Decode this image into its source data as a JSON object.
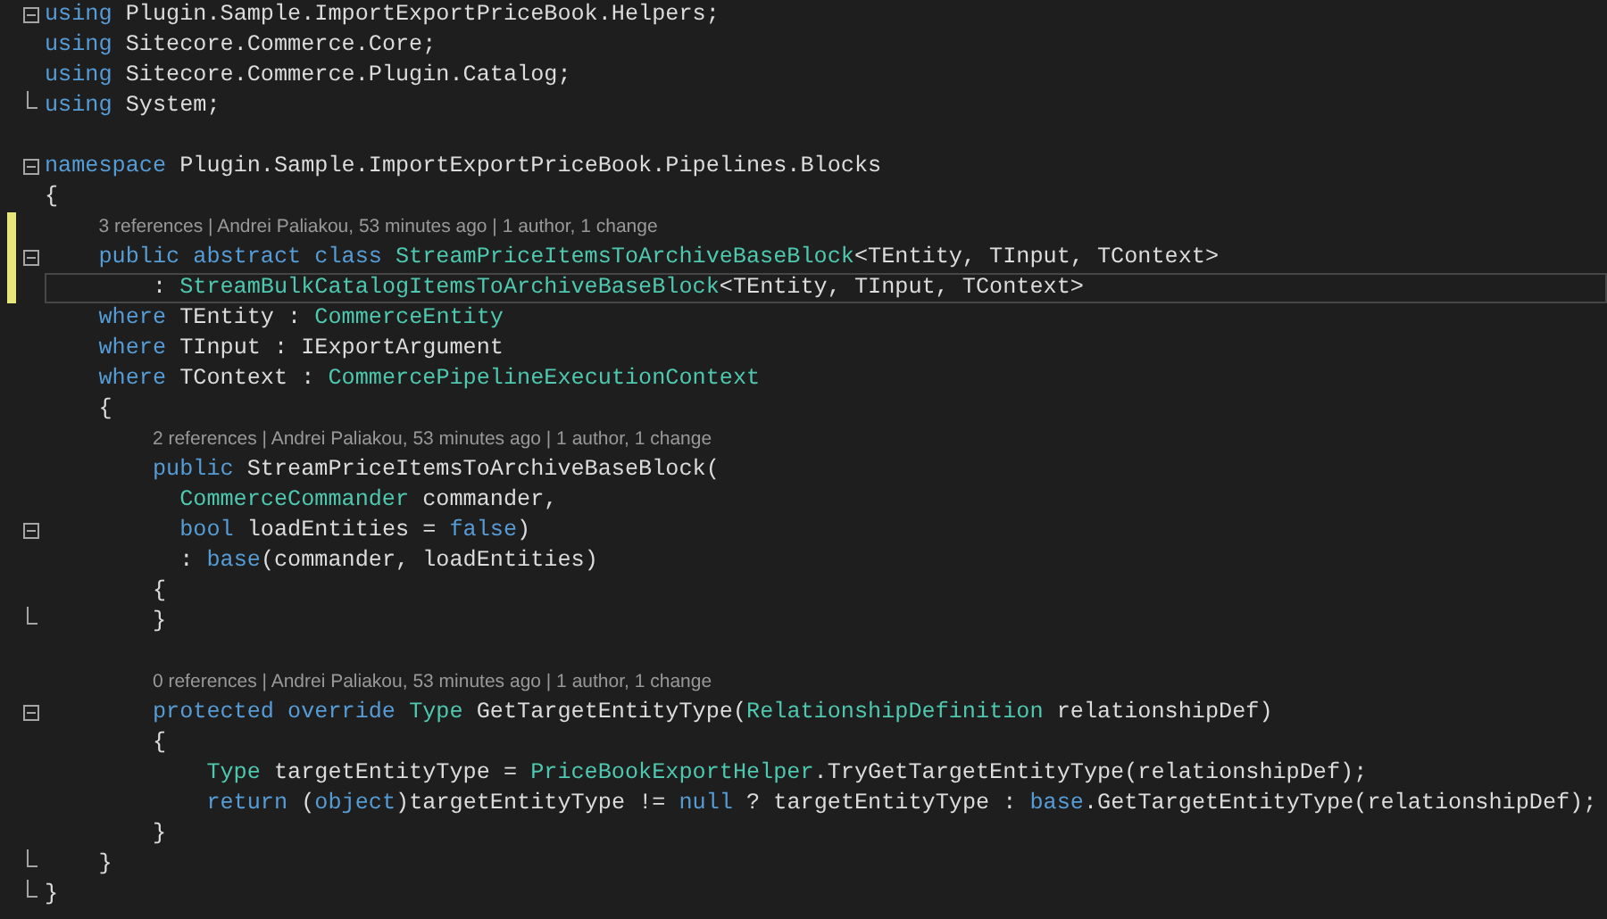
{
  "editor": {
    "lines": [
      {
        "kind": "code",
        "collapsible": true,
        "fold_end": false,
        "changed": false,
        "current": false,
        "tokens": [
          {
            "kind": "keyword",
            "text": "using"
          },
          {
            "kind": "plain",
            "text": " Plugin.Sample.ImportExportPriceBook.Helpers;"
          }
        ]
      },
      {
        "kind": "code",
        "collapsible": false,
        "fold_end": false,
        "changed": false,
        "current": false,
        "tokens": [
          {
            "kind": "keyword",
            "text": "using"
          },
          {
            "kind": "plain",
            "text": " Sitecore.Commerce.Core;"
          }
        ]
      },
      {
        "kind": "code",
        "collapsible": false,
        "fold_end": false,
        "changed": false,
        "current": false,
        "tokens": [
          {
            "kind": "keyword",
            "text": "using"
          },
          {
            "kind": "plain",
            "text": " Sitecore.Commerce.Plugin.Catalog;"
          }
        ]
      },
      {
        "kind": "code",
        "collapsible": false,
        "fold_end": true,
        "changed": false,
        "current": false,
        "tokens": [
          {
            "kind": "keyword",
            "text": "using"
          },
          {
            "kind": "plain",
            "text": " System;"
          }
        ]
      },
      {
        "kind": "blank"
      },
      {
        "kind": "code",
        "collapsible": true,
        "fold_end": false,
        "changed": false,
        "current": false,
        "tokens": [
          {
            "kind": "keyword",
            "text": "namespace"
          },
          {
            "kind": "plain",
            "text": " Plugin.Sample.ImportExportPriceBook.Pipelines.Blocks"
          }
        ]
      },
      {
        "kind": "code",
        "collapsible": false,
        "fold_end": false,
        "changed": false,
        "current": false,
        "tokens": [
          {
            "kind": "plain",
            "text": "{"
          }
        ]
      },
      {
        "kind": "lens",
        "collapsible": false,
        "fold_end": false,
        "changed": true,
        "current": false,
        "text": "3 references | Andrei Paliakou, 53 minutes ago | 1 author, 1 change"
      },
      {
        "kind": "code",
        "collapsible": true,
        "fold_end": false,
        "changed": true,
        "current": false,
        "tokens": [
          {
            "kind": "keyword",
            "text": "    public abstract class "
          },
          {
            "kind": "type",
            "text": "StreamPriceItemsToArchiveBaseBlock"
          },
          {
            "kind": "plain",
            "text": "<TEntity, TInput, TContext>"
          }
        ]
      },
      {
        "kind": "code",
        "collapsible": false,
        "fold_end": false,
        "changed": true,
        "current": true,
        "tokens": [
          {
            "kind": "plain",
            "text": "        : "
          },
          {
            "kind": "type",
            "text": "StreamBulkCatalogItemsToArchiveBaseBlock"
          },
          {
            "kind": "plain",
            "text": "<TEntity, TInput, TContext>"
          }
        ]
      },
      {
        "kind": "code",
        "collapsible": false,
        "fold_end": false,
        "changed": false,
        "current": false,
        "tokens": [
          {
            "kind": "keyword",
            "text": "    where"
          },
          {
            "kind": "plain",
            "text": " TEntity : "
          },
          {
            "kind": "type",
            "text": "CommerceEntity"
          }
        ]
      },
      {
        "kind": "code",
        "collapsible": false,
        "fold_end": false,
        "changed": false,
        "current": false,
        "tokens": [
          {
            "kind": "keyword",
            "text": "    where"
          },
          {
            "kind": "plain",
            "text": " TInput : IExportArgument"
          }
        ]
      },
      {
        "kind": "code",
        "collapsible": false,
        "fold_end": false,
        "changed": false,
        "current": false,
        "tokens": [
          {
            "kind": "keyword",
            "text": "    where"
          },
          {
            "kind": "plain",
            "text": " TContext : "
          },
          {
            "kind": "type",
            "text": "CommercePipelineExecutionContext"
          }
        ]
      },
      {
        "kind": "code",
        "collapsible": false,
        "fold_end": false,
        "changed": false,
        "current": false,
        "tokens": [
          {
            "kind": "plain",
            "text": "    {"
          }
        ]
      },
      {
        "kind": "lens",
        "collapsible": false,
        "fold_end": false,
        "changed": false,
        "current": false,
        "text": "2 references | Andrei Paliakou, 53 minutes ago | 1 author, 1 change"
      },
      {
        "kind": "code",
        "collapsible": false,
        "fold_end": false,
        "changed": false,
        "current": false,
        "tokens": [
          {
            "kind": "keyword",
            "text": "        public"
          },
          {
            "kind": "plain",
            "text": " StreamPriceItemsToArchiveBaseBlock("
          }
        ]
      },
      {
        "kind": "code",
        "collapsible": false,
        "fold_end": false,
        "changed": false,
        "current": false,
        "tokens": [
          {
            "kind": "type",
            "text": "          CommerceCommander"
          },
          {
            "kind": "plain",
            "text": " commander,"
          }
        ]
      },
      {
        "kind": "code",
        "collapsible": true,
        "fold_end": false,
        "changed": false,
        "current": false,
        "tokens": [
          {
            "kind": "keyword",
            "text": "          bool"
          },
          {
            "kind": "plain",
            "text": " loadEntities = "
          },
          {
            "kind": "keyword",
            "text": "false"
          },
          {
            "kind": "plain",
            "text": ")"
          }
        ]
      },
      {
        "kind": "code",
        "collapsible": false,
        "fold_end": false,
        "changed": false,
        "current": false,
        "tokens": [
          {
            "kind": "plain",
            "text": "          : "
          },
          {
            "kind": "keyword",
            "text": "base"
          },
          {
            "kind": "plain",
            "text": "(commander, loadEntities)"
          }
        ]
      },
      {
        "kind": "code",
        "collapsible": false,
        "fold_end": false,
        "changed": false,
        "current": false,
        "tokens": [
          {
            "kind": "plain",
            "text": "        {"
          }
        ]
      },
      {
        "kind": "code",
        "collapsible": false,
        "fold_end": true,
        "changed": false,
        "current": false,
        "tokens": [
          {
            "kind": "plain",
            "text": "        }"
          }
        ]
      },
      {
        "kind": "blank"
      },
      {
        "kind": "lens",
        "collapsible": false,
        "fold_end": false,
        "changed": false,
        "current": false,
        "text": "0 references | Andrei Paliakou, 53 minutes ago | 1 author, 1 change"
      },
      {
        "kind": "code",
        "collapsible": true,
        "fold_end": false,
        "changed": false,
        "current": false,
        "tokens": [
          {
            "kind": "keyword",
            "text": "        protected override "
          },
          {
            "kind": "type",
            "text": "Type"
          },
          {
            "kind": "plain",
            "text": " GetTargetEntityType("
          },
          {
            "kind": "type",
            "text": "RelationshipDefinition"
          },
          {
            "kind": "plain",
            "text": " relationshipDef)"
          }
        ]
      },
      {
        "kind": "code",
        "collapsible": false,
        "fold_end": false,
        "changed": false,
        "current": false,
        "tokens": [
          {
            "kind": "plain",
            "text": "        {"
          }
        ]
      },
      {
        "kind": "code",
        "collapsible": false,
        "fold_end": false,
        "changed": false,
        "current": false,
        "tokens": [
          {
            "kind": "type",
            "text": "            Type"
          },
          {
            "kind": "plain",
            "text": " targetEntityType = "
          },
          {
            "kind": "type",
            "text": "PriceBookExportHelper"
          },
          {
            "kind": "plain",
            "text": ".TryGetTargetEntityType(relationshipDef);"
          }
        ]
      },
      {
        "kind": "code",
        "collapsible": false,
        "fold_end": false,
        "changed": false,
        "current": false,
        "tokens": [
          {
            "kind": "keyword",
            "text": "            return"
          },
          {
            "kind": "plain",
            "text": " ("
          },
          {
            "kind": "keyword",
            "text": "object"
          },
          {
            "kind": "plain",
            "text": ")targetEntityType != "
          },
          {
            "kind": "keyword",
            "text": "null"
          },
          {
            "kind": "plain",
            "text": " ? targetEntityType : "
          },
          {
            "kind": "keyword",
            "text": "base"
          },
          {
            "kind": "plain",
            "text": ".GetTargetEntityType(relationshipDef);"
          }
        ]
      },
      {
        "kind": "code",
        "collapsible": false,
        "fold_end": false,
        "changed": false,
        "current": false,
        "tokens": [
          {
            "kind": "plain",
            "text": "        }"
          }
        ]
      },
      {
        "kind": "code",
        "collapsible": false,
        "fold_end": true,
        "changed": false,
        "current": false,
        "tokens": [
          {
            "kind": "plain",
            "text": "    }"
          }
        ]
      },
      {
        "kind": "code",
        "collapsible": false,
        "fold_end": true,
        "changed": false,
        "current": false,
        "tokens": [
          {
            "kind": "plain",
            "text": "}"
          }
        ]
      }
    ]
  }
}
